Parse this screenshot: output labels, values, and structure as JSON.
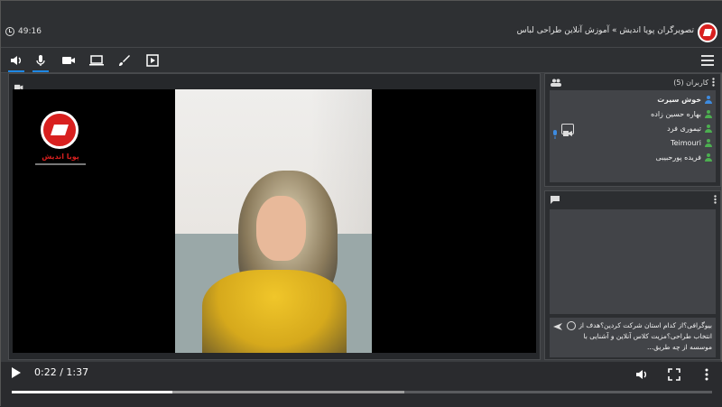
{
  "header": {
    "clock_time": "49:16",
    "title": "تصویرگران پویا اندیش » آموزش آنلاین طراحی لباس"
  },
  "toolbar": {
    "icons": [
      "volume-icon",
      "microphone-icon",
      "camera-icon",
      "screen-share-icon",
      "whiteboard-brush-icon",
      "presentation-icon"
    ],
    "menu_icon": "hamburger-menu-icon"
  },
  "video": {
    "logo_text": "پویا اندیش",
    "panel_icon": "camera-icon"
  },
  "users_panel": {
    "title": "کاربران (5)",
    "users": [
      {
        "name": "خوش سیرت",
        "color": "#3d8be0",
        "bold": true
      },
      {
        "name": "بهاره حسین زاده",
        "color": "#4caf50",
        "bold": false
      },
      {
        "name": "تیموری فرد",
        "color": "#4caf50",
        "bold": false
      },
      {
        "name": "Teimouri",
        "color": "#4caf50",
        "bold": false
      },
      {
        "name": "فریده پورحبیبی",
        "color": "#4caf50",
        "bold": false
      }
    ]
  },
  "chat_panel": {
    "message": "بیوگرافی؟از کدام استان شرکت کردین؟هدف از انتخاب طراحی؟مزیت کلاس آنلاین و آشنایی با موسسه از چه طریق..."
  },
  "playback": {
    "current_time": "0:22",
    "separator": "/",
    "duration": "1:37",
    "played_fraction": 0.23,
    "buffered_fraction": 0.56
  },
  "colors": {
    "accent": "#1e88e5",
    "brand_red": "#d8201f",
    "user_green": "#4caf50",
    "user_blue": "#3d8be0"
  }
}
